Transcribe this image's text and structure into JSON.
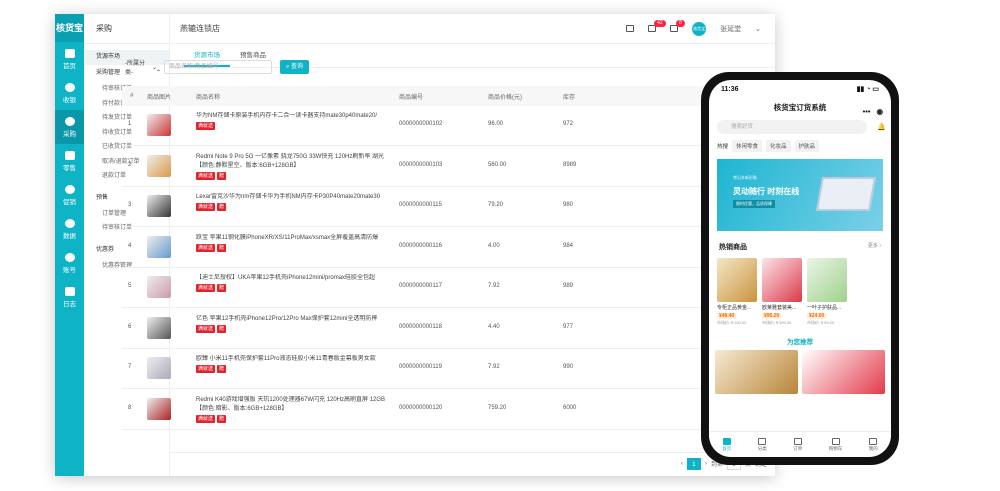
{
  "app": {
    "logo": "核货宝",
    "page_title": "燕辘连锁店"
  },
  "rail": [
    {
      "label": "首页"
    },
    {
      "label": "收银"
    },
    {
      "label": "采购"
    },
    {
      "label": "零售"
    },
    {
      "label": "促销"
    },
    {
      "label": "数据"
    },
    {
      "label": "账号"
    },
    {
      "label": "日志"
    }
  ],
  "side": {
    "title": "采购",
    "market": "货源市场",
    "groups": [
      {
        "title": "采购管理",
        "items": [
          "待审核订单",
          "待付款订单",
          "待发货订单",
          "待收货订单",
          "已收货订单",
          "取消/退款订单",
          "退款订单"
        ]
      },
      {
        "title": "预售",
        "items": [
          "订单管理",
          "待审核订单"
        ]
      },
      {
        "title": "优惠券",
        "items": [
          "优惠券管理"
        ]
      }
    ]
  },
  "header": {
    "badge1": "42",
    "badge2": "8",
    "avatar": "核货宝",
    "user": "张延堂"
  },
  "tabs": [
    "货源市场",
    "预售商品"
  ],
  "filter": {
    "select_label": "-所属分类-",
    "placeholder": "商品名称/商品编号",
    "search_btn": "查询"
  },
  "table": {
    "headers": {
      "idx": "#",
      "img": "商品图片",
      "name": "商品名称",
      "code": "商品编号",
      "price": "商品价格(元)",
      "stock": "库存"
    },
    "rows": [
      {
        "idx": "1",
        "line1": "华为NM存储卡原装手机内存卡二合一读卡器支持mate30p40mate20/",
        "line2": "",
        "tags": [
          "满就送"
        ],
        "code": "0000000000102",
        "price": "96.00",
        "stock": "972"
      },
      {
        "idx": "2",
        "line1": "Redmi Note 9 Pro 5G 一亿像素 骁龙750G 33W快充 120Hz刷新率 湖光",
        "line2": "【颜色:静默星空、版本:6GB+128GB】",
        "tags": [
          "满就送",
          "赠"
        ],
        "code": "0000000000103",
        "price": "560.00",
        "stock": "8989"
      },
      {
        "idx": "3",
        "line1": "Lexar雷克沙华为nm存储卡华为手机NM内存卡P30P40mate20mate30",
        "line2": "",
        "tags": [
          "满就送",
          "赠"
        ],
        "code": "0000000000115",
        "price": "79.20",
        "stock": "980"
      },
      {
        "idx": "4",
        "line1": "跃宝 苹果11钢化膜iPhoneXR/XS/11ProMax/xsmax全屏覆盖高清防爆",
        "line2": "",
        "tags": [
          "满就送",
          "赠"
        ],
        "code": "0000000000116",
        "price": "4.00",
        "stock": "984"
      },
      {
        "idx": "5",
        "line1": "【迪士尼授权】UKA苹果12手机壳iPhone12mini/promax硅胶全包超",
        "line2": "",
        "tags": [
          "满就送",
          "赠"
        ],
        "code": "0000000000117",
        "price": "7.92",
        "stock": "989"
      },
      {
        "idx": "6",
        "line1": "亿色 苹果12手机壳iPhone12Pro/12Pro Max保护套12mini全透明防摔",
        "line2": "",
        "tags": [
          "满就送",
          "赠"
        ],
        "code": "0000000000118",
        "price": "4.40",
        "stock": "977"
      },
      {
        "idx": "7",
        "line1": "欧臻 小米11手机壳保护套11Pro液态硅胶小米11青春版金幕板男女款",
        "line2": "",
        "tags": [
          "满就送",
          "赠"
        ],
        "code": "0000000000119",
        "price": "7.92",
        "stock": "990"
      },
      {
        "idx": "8",
        "line1": "Redmi K40游戏增强版 天玑1200处理器67W闪充 120Hz高刷直屏 12GB",
        "line2": "【颜色:暗影、版本:6GB+128GB】",
        "tags": [
          "满就送",
          "赠"
        ],
        "code": "0000000000120",
        "price": "759.20",
        "stock": "6000"
      }
    ]
  },
  "pager": {
    "page": "1",
    "goto": "到第",
    "goto_val": "1",
    "unit": "页",
    "confirm": "确定"
  },
  "phone": {
    "time": "11:36",
    "title": "核货宝订货系统",
    "search": "搜索好货",
    "hot_label": "热搜",
    "chips": [
      "休闲零食",
      "化妆品",
      "护肤品"
    ],
    "banner_small": "常记本新形象",
    "banner_big": "灵动随行  时刻在线",
    "banner_tag": "限时优惠，品质保障",
    "section_title": "热销商品",
    "more": "更多",
    "products": [
      {
        "name": "专柜正品黄金...",
        "price": "¥48.40",
        "orig": "市场价:￥150.00"
      },
      {
        "name": "欧莱雅套装美...",
        "price": "¥95.20",
        "orig": "市场价:￥399.00"
      },
      {
        "name": "一叶子护肤品...",
        "price": "¥24.00",
        "orig": "市场价:￥99.00"
      }
    ],
    "recommend": "为您推荐",
    "nav": [
      "首页",
      "分类",
      "订单",
      "购物车",
      "我的"
    ]
  }
}
